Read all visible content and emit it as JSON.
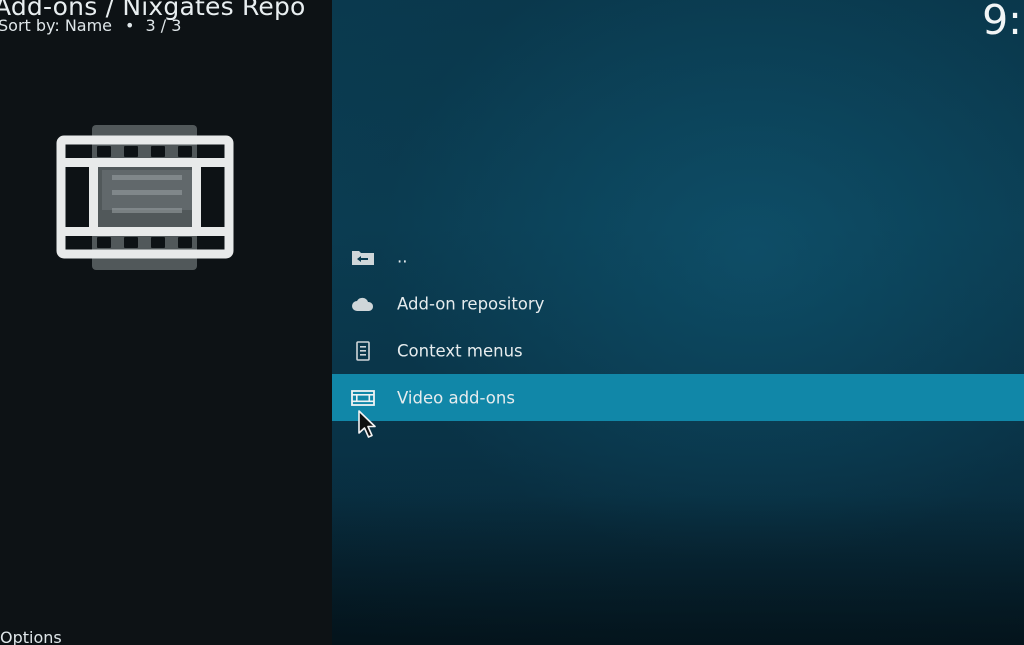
{
  "header": {
    "title": "Add-ons / Nixgates Repo",
    "sort_label": "Sort by: Name",
    "page_counter": "3 / 3",
    "clock": "9:"
  },
  "footer": {
    "options_label": "Options"
  },
  "thumbnail": {
    "icon": "film-strip-icon"
  },
  "list": {
    "items": [
      {
        "label": "..",
        "icon": "folder-back-icon"
      },
      {
        "label": "Add-on repository",
        "icon": "cloud-icon"
      },
      {
        "label": "Context menus",
        "icon": "context-menu-icon"
      },
      {
        "label": "Video add-ons",
        "icon": "film-icon",
        "focused": true
      }
    ]
  },
  "colors": {
    "focus_highlight": "#1187a8",
    "background_right": "#0b3f55",
    "background_left": "#0d1215"
  }
}
